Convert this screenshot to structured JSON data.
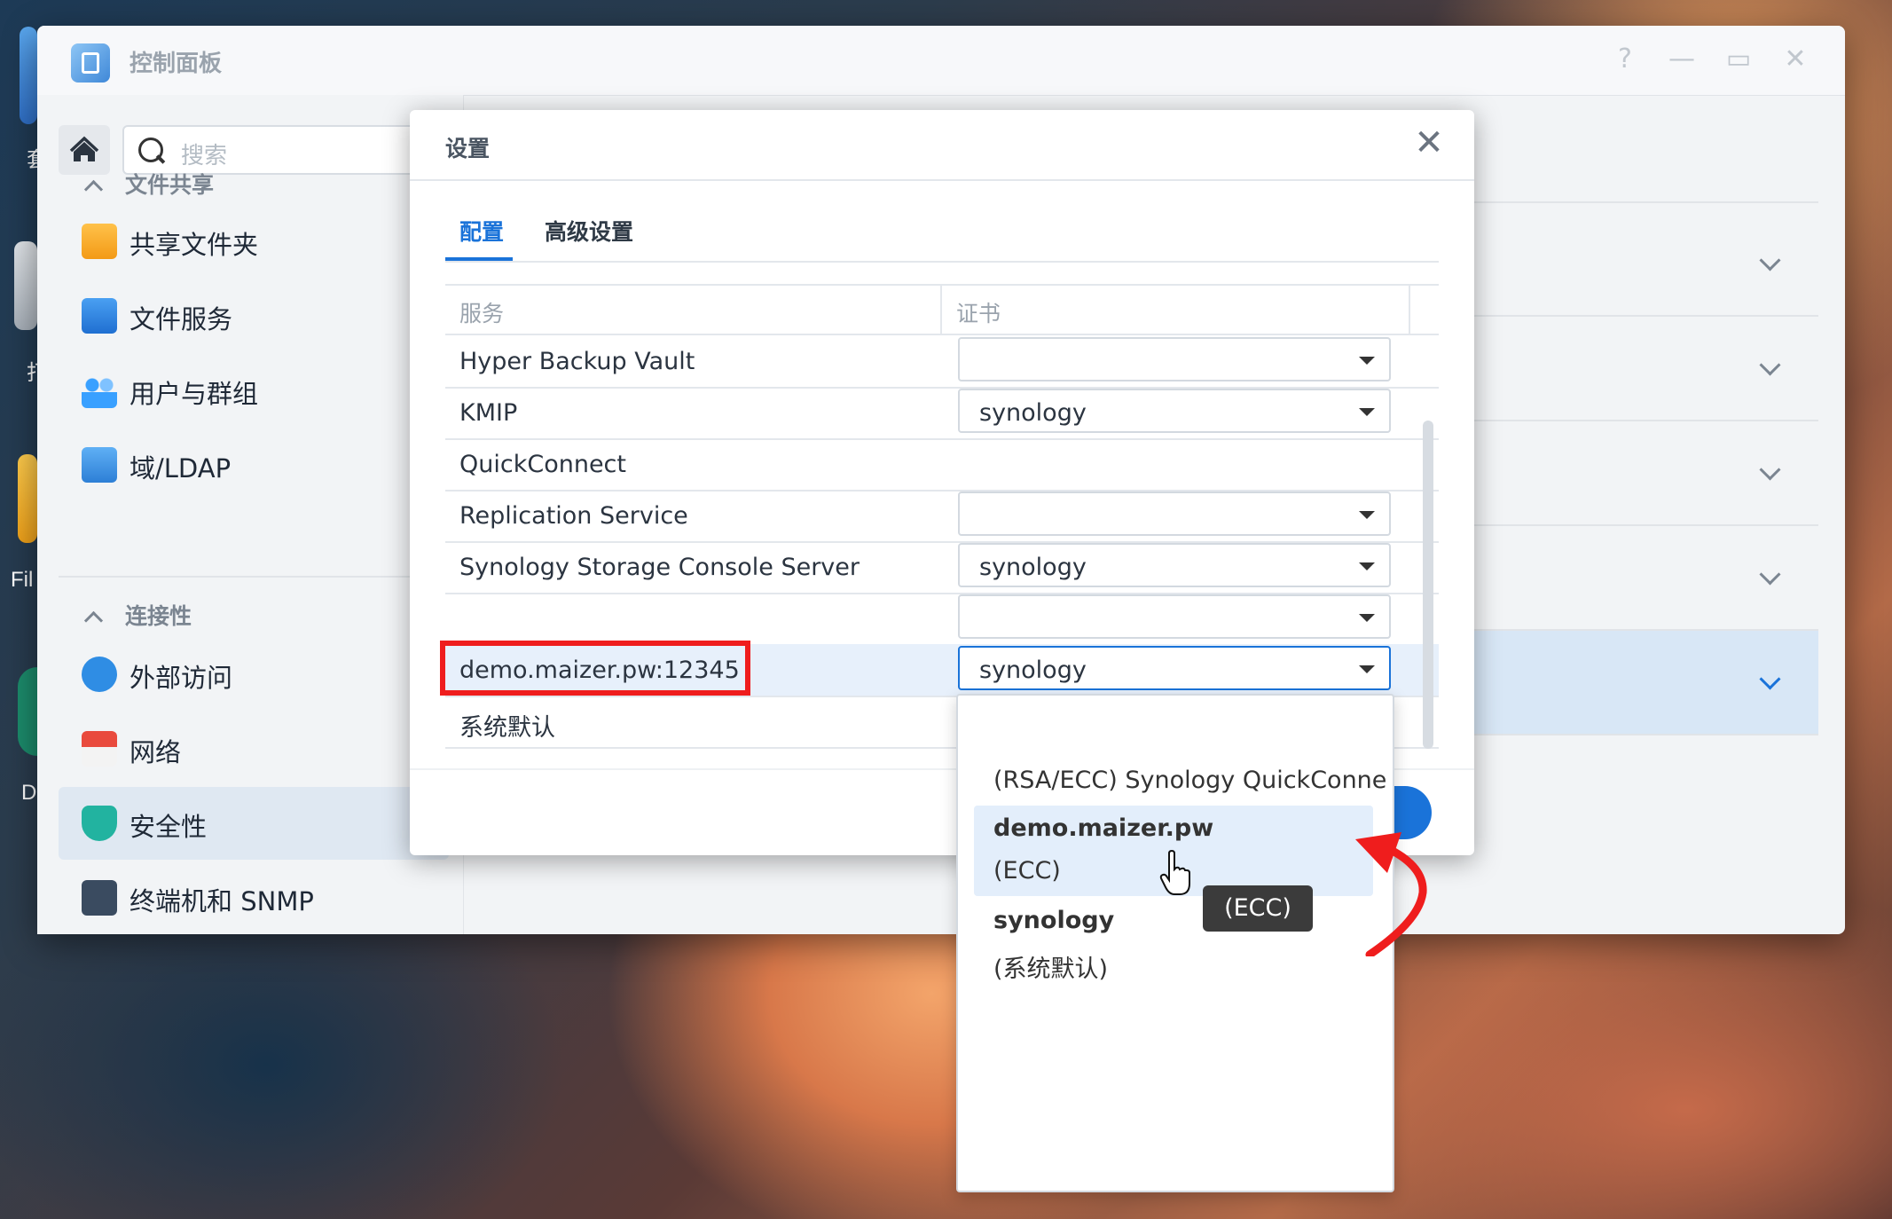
{
  "window": {
    "title": "控制面板",
    "help": "?",
    "minimize": "—",
    "maximize": "▭",
    "close": "✕"
  },
  "desktop": {
    "labels": [
      "套",
      "打",
      "Fil",
      "D"
    ]
  },
  "sidebar": {
    "search_placeholder": "搜索",
    "sections": [
      {
        "label": "文件共享",
        "items": [
          "共享文件夹",
          "文件服务",
          "用户与群组",
          "域/LDAP"
        ]
      },
      {
        "label": "连接性",
        "items": [
          "外部访问",
          "网络",
          "安全性",
          "终端机和 SNMP"
        ]
      }
    ],
    "active_item": "安全性"
  },
  "dialog": {
    "title": "设置",
    "close": "✕",
    "tabs": [
      "配置",
      "高级设置"
    ],
    "active_tab": "配置",
    "columns": [
      "服务",
      "证书"
    ],
    "rows": [
      {
        "service": "Hyper Backup Vault",
        "cert": "",
        "has_select": true
      },
      {
        "service": "KMIP",
        "cert": "synology",
        "has_select": true
      },
      {
        "service": "QuickConnect",
        "cert": "",
        "has_select": false
      },
      {
        "service": "Replication Service",
        "cert": "",
        "has_select": true
      },
      {
        "service": "Synology Storage Console Server",
        "cert": "synology",
        "has_select": true
      },
      {
        "service": "",
        "cert": "",
        "has_select": true
      },
      {
        "service": "demo.maizer.pw:12345",
        "cert": "synology",
        "has_select": true,
        "highlighted": true
      },
      {
        "service": "系统默认",
        "cert": "",
        "has_select": false
      }
    ]
  },
  "dropdown": {
    "options": [
      {
        "line1": "(RSA/ECC) Synology QuickConne",
        "line2": ""
      },
      {
        "line1": "demo.maizer.pw",
        "line2": "(ECC)",
        "hover": true
      },
      {
        "line1": "synology",
        "line2": "(系统默认)"
      }
    ],
    "tooltip": "(ECC)"
  },
  "colors": {
    "accent": "#1a73d9",
    "annotation_red": "#ef1d1d"
  }
}
